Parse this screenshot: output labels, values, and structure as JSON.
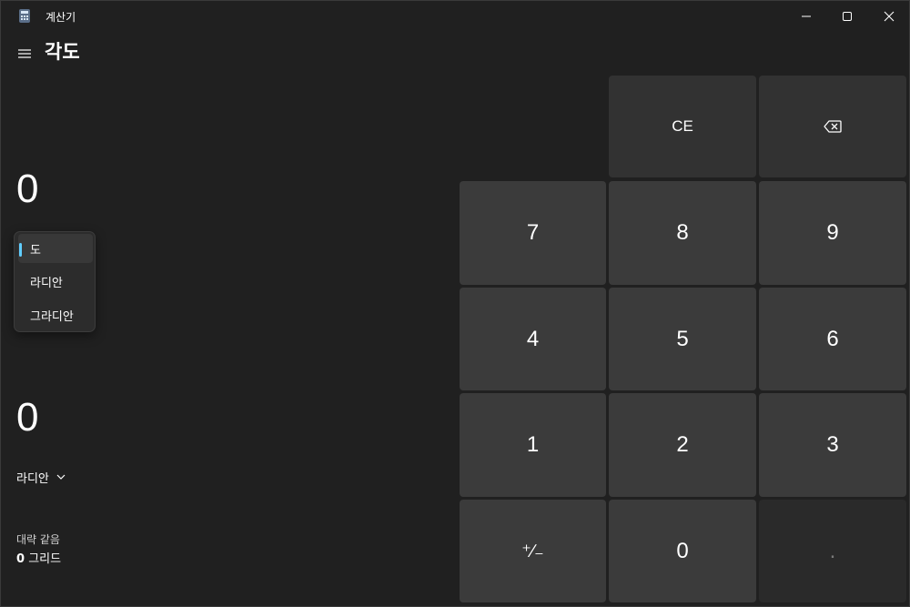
{
  "window": {
    "title": "계산기"
  },
  "header": {
    "mode_title": "각도"
  },
  "converter": {
    "from_value": "0",
    "from_unit_options": [
      "도",
      "라디안",
      "그라디안"
    ],
    "from_unit_selected": "도",
    "to_value": "0",
    "to_unit": "라디안",
    "approx_label": "대략 같음",
    "approx_value": "0",
    "approx_unit": "그리드"
  },
  "keypad": {
    "ce": "CE",
    "digits": [
      "7",
      "8",
      "9",
      "4",
      "5",
      "6",
      "1",
      "2",
      "3",
      "0"
    ],
    "sign": "⁺∕₋",
    "decimal": "."
  },
  "colors": {
    "background": "#202020",
    "key": "#3b3b3b",
    "accent": "#60cdff"
  },
  "icons": [
    "calculator-icon",
    "minimize-icon",
    "maximize-icon",
    "close-icon",
    "hamburger-menu-icon",
    "backspace-icon",
    "chevron-down-icon"
  ]
}
